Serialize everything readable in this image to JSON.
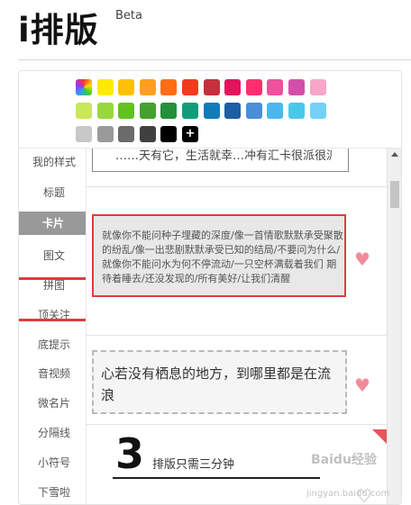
{
  "app": {
    "logo": "i排版",
    "badge": "Beta"
  },
  "palette": {
    "colors": [
      [
        "#rainbow",
        "#ffea00",
        "#ffc107",
        "#ff9f21",
        "#ff6d16",
        "#f23b1b",
        "#c7303d",
        "#e3145b",
        "#ff2e6f",
        "#f0509c",
        "#d44ea8",
        "#f7a6c7"
      ],
      [
        "#c8e85a",
        "#98d83f",
        "#62c21f",
        "#44a12d",
        "#25903b",
        "#129d78",
        "#0f7bb8",
        "#1c5fa5",
        "#4a8dd8",
        "#4ab8ef",
        "#49c9e9",
        "#74d1f6"
      ],
      [
        "#c8c8c8",
        "#9a9a9a",
        "#6b6b6b",
        "#404040",
        "#000000",
        "#add"
      ]
    ]
  },
  "sidebar": {
    "items": [
      "我的样式",
      "标题",
      "卡片",
      "图文",
      "拼图",
      "顶关注",
      "底提示",
      "音视频",
      "微名片",
      "分隔线",
      "小符号",
      "下雪啦"
    ],
    "active_index": 2
  },
  "content": {
    "partial_text": "……天有它，生活就幸…冲有汇卡很派很派……",
    "card_text": "就像你不能问种子埋藏的深度/像一首情歌默默承受聚散的纷乱/像一出悲剧默默承受已知的结局/不要问为什么/就像你不能问水为何不停流动/一只空杯满载着我们 期待着睡去/还没发现的/所有美好/让我们清醒",
    "dashed_text": "心若没有栖息的地方，到哪里都是在流浪",
    "num_big": "3",
    "num_caption": "排版只需三分钟"
  },
  "watermark": {
    "text": "Baidu经验",
    "sub": "jingyan.baidu.com"
  }
}
